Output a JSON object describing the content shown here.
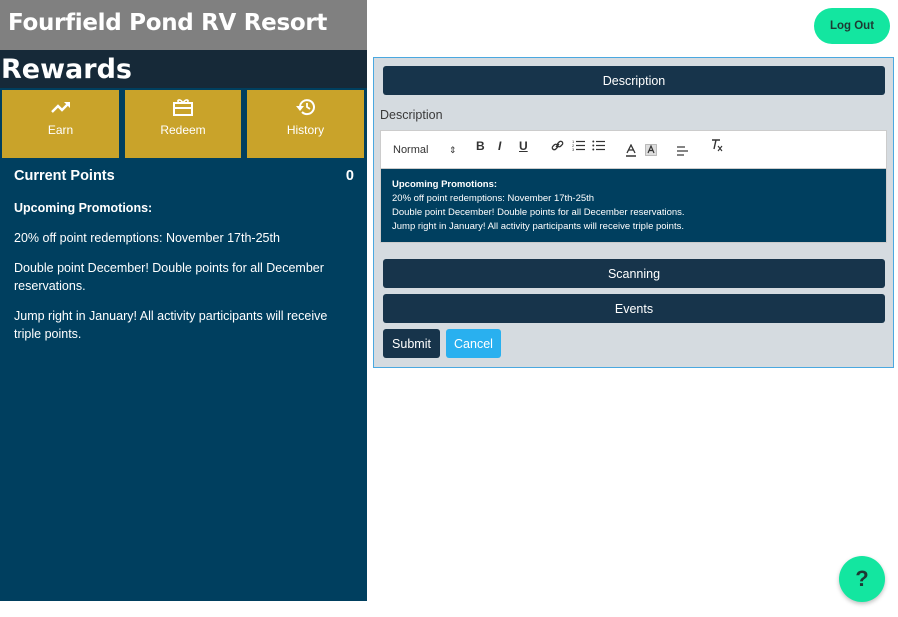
{
  "header": {
    "resort_name": "Fourfield Pond RV Resort",
    "logout_label": "Log Out"
  },
  "rewards": {
    "title": "Rewards",
    "tiles": [
      {
        "label": "Earn",
        "icon": "trending-up-icon"
      },
      {
        "label": "Redeem",
        "icon": "gift-icon"
      },
      {
        "label": "History",
        "icon": "history-icon"
      }
    ],
    "current_points_label": "Current Points",
    "current_points_value": "0",
    "promotions_heading": "Upcoming Promotions:",
    "promotions": [
      "20% off point redemptions: November 17th-25th",
      "Double point December! Double points for all December reservations.",
      "Jump right in January! All activity participants will receive triple points."
    ]
  },
  "editor_panel": {
    "description_header": "Description",
    "description_label": "Description",
    "toolbar": {
      "format_select": "Normal",
      "bold": "B",
      "italic": "I",
      "underline": "U"
    },
    "content": {
      "heading": "Upcoming Promotions:",
      "lines": [
        "20% off point redemptions: November 17th-25th",
        "Double point December! Double points for all December reservations.",
        "Jump right in January! All activity participants will receive triple points."
      ]
    },
    "scanning_label": "Scanning",
    "events_label": "Events",
    "submit_label": "Submit",
    "cancel_label": "Cancel"
  },
  "help": {
    "label": "?"
  },
  "colors": {
    "sidebar_bg": "#003f5f",
    "header_gray": "#808080",
    "rewards_bar": "#162938",
    "tile_gold": "#c9a32a",
    "accent_green": "#13e6a0",
    "navy_button": "#17344b",
    "cancel_blue": "#29b0ef"
  }
}
